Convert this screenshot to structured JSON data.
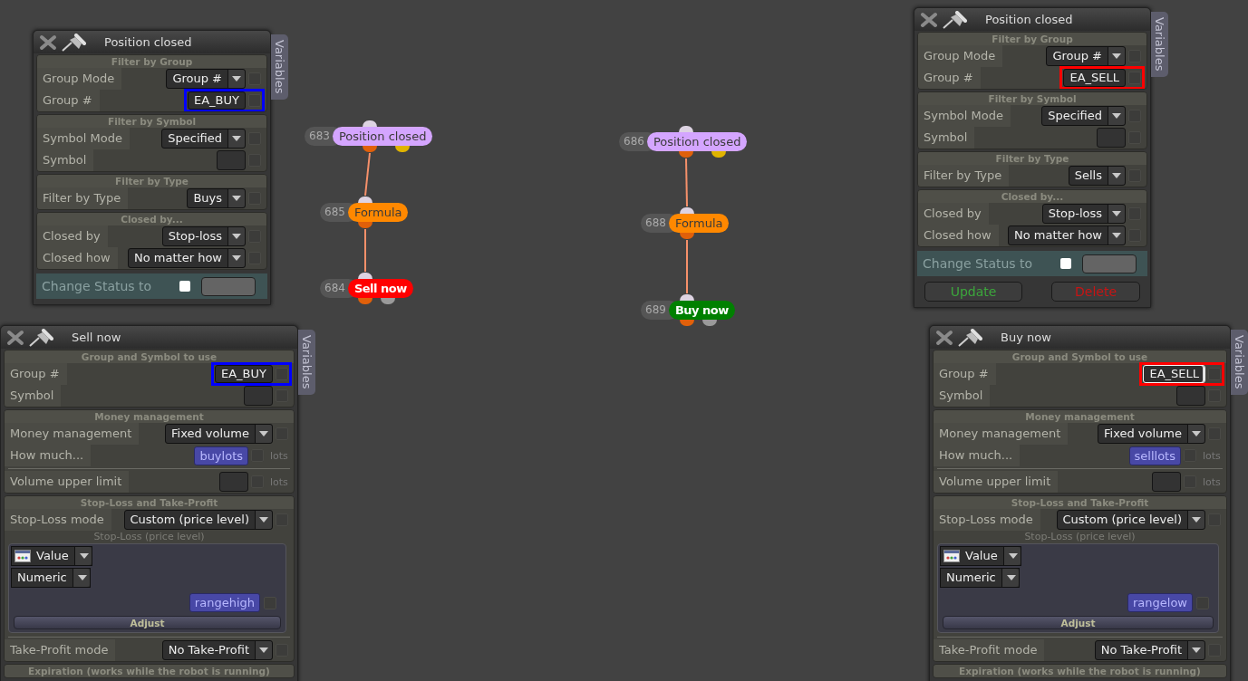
{
  "flows": [
    {
      "nodes": [
        {
          "number": "683",
          "label": "Position closed",
          "kind": "trigger",
          "color": "#d4a5ff"
        },
        {
          "number": "685",
          "label": "Formula",
          "kind": "formula",
          "color": "#ff8800"
        },
        {
          "number": "684",
          "label": "Sell now",
          "kind": "action",
          "color": "#ff0000"
        }
      ]
    },
    {
      "nodes": [
        {
          "number": "686",
          "label": "Position closed",
          "kind": "trigger",
          "color": "#d4a5ff"
        },
        {
          "number": "688",
          "label": "Formula",
          "kind": "formula",
          "color": "#ff8800"
        },
        {
          "number": "689",
          "label": "Buy now",
          "kind": "action",
          "color": "#008000"
        }
      ]
    }
  ],
  "panels": [
    {
      "title": "Position closed",
      "tab": "Variables",
      "sections": [
        {
          "heading": "Filter by Group",
          "rows": [
            {
              "kind": "field",
              "label": "Group Mode",
              "control": {
                "kind": "select",
                "value": "Group #"
              },
              "checked": false
            },
            {
              "kind": "field",
              "label": "Group #",
              "control": {
                "kind": "text",
                "value": "EA_BUY",
                "focused": false
              },
              "checked": false,
              "color": "#0000ff"
            }
          ]
        },
        {
          "heading": "Filter by Symbol",
          "rows": [
            {
              "kind": "field",
              "label": "Symbol Mode",
              "control": {
                "kind": "select",
                "value": "Specified"
              },
              "checked": false
            },
            {
              "kind": "field",
              "label": "Symbol",
              "control": {
                "kind": "empty"
              },
              "checked": false
            }
          ]
        },
        {
          "heading": "Filter by Type",
          "rows": [
            {
              "kind": "field",
              "label": "Filter by Type",
              "control": {
                "kind": "select",
                "value": "Buys"
              },
              "checked": false
            }
          ]
        },
        {
          "heading": "Closed by...",
          "rows": [
            {
              "kind": "field",
              "label": "Closed by",
              "control": {
                "kind": "select",
                "value": "Stop-loss"
              },
              "checked": false
            },
            {
              "kind": "field",
              "label": "Closed how",
              "control": {
                "kind": "select",
                "value": "No matter how"
              },
              "checked": false
            }
          ]
        }
      ],
      "status": {
        "label": "Change Status to",
        "checked": false
      }
    },
    {
      "title": "Sell now",
      "tab": "Variables",
      "sections": [
        {
          "heading": "Group and Symbol to use",
          "rows": [
            {
              "kind": "field",
              "label": "Group #",
              "control": {
                "kind": "text",
                "value": "EA_BUY",
                "focused": false
              },
              "checked": false,
              "color": "#0000ff"
            },
            {
              "kind": "field",
              "label": "Symbol",
              "control": {
                "kind": "empty"
              },
              "checked": false
            }
          ]
        },
        {
          "heading": "Money management",
          "rows": [
            {
              "kind": "field",
              "label": "Money management",
              "control": {
                "kind": "select",
                "value": "Fixed volume"
              },
              "checked": false
            },
            {
              "kind": "field",
              "label": "How much...",
              "control": {
                "kind": "variable",
                "value": "buylots"
              },
              "unit": "lots",
              "checked": false
            },
            {
              "kind": "divider"
            },
            {
              "kind": "field",
              "label": "Volume upper limit",
              "control": {
                "kind": "empty"
              },
              "unit": "lots",
              "checked": false
            }
          ]
        },
        {
          "heading": "Stop-Loss and Take-Profit",
          "rows": [
            {
              "kind": "field",
              "label": "Stop-Loss mode",
              "control": {
                "kind": "select",
                "value": "Custom (price level)"
              },
              "checked": false
            },
            {
              "kind": "caption",
              "text": "Stop-Loss (price level)"
            },
            {
              "kind": "expression",
              "source": "Value",
              "type": "Numeric",
              "variable": "rangehigh",
              "button": "Adjust",
              "checked": false
            },
            {
              "kind": "divider"
            },
            {
              "kind": "field",
              "label": "Take-Profit mode",
              "control": {
                "kind": "select",
                "value": "No Take-Profit"
              },
              "checked": false
            }
          ]
        },
        {
          "heading": "Expiration (works while the robot is running)"
        }
      ]
    },
    {
      "title": "Position closed",
      "tab": "Variables",
      "sections": [
        {
          "heading": "Filter by Group",
          "rows": [
            {
              "kind": "field",
              "label": "Group Mode",
              "control": {
                "kind": "select",
                "value": "Group #"
              },
              "checked": false
            },
            {
              "kind": "field",
              "label": "Group #",
              "control": {
                "kind": "text",
                "value": "EA_SELL",
                "focused": false
              },
              "checked": false,
              "color": "#ff0000"
            }
          ]
        },
        {
          "heading": "Filter by Symbol",
          "rows": [
            {
              "kind": "field",
              "label": "Symbol Mode",
              "control": {
                "kind": "select",
                "value": "Specified"
              },
              "checked": false
            },
            {
              "kind": "field",
              "label": "Symbol",
              "control": {
                "kind": "empty"
              },
              "checked": false
            }
          ]
        },
        {
          "heading": "Filter by Type",
          "rows": [
            {
              "kind": "field",
              "label": "Filter by Type",
              "control": {
                "kind": "select",
                "value": "Sells"
              },
              "checked": false
            }
          ]
        },
        {
          "heading": "Closed by...",
          "rows": [
            {
              "kind": "field",
              "label": "Closed by",
              "control": {
                "kind": "select",
                "value": "Stop-loss"
              },
              "checked": false
            },
            {
              "kind": "field",
              "label": "Closed how",
              "control": {
                "kind": "select",
                "value": "No matter how"
              },
              "checked": false
            }
          ]
        }
      ],
      "status": {
        "label": "Change Status to",
        "checked": false
      },
      "buttons": [
        {
          "label": "Update",
          "kind": "update"
        },
        {
          "label": "Delete",
          "kind": "delete"
        }
      ]
    },
    {
      "title": "Buy now",
      "tab": "Variables",
      "sections": [
        {
          "heading": "Group and Symbol to use",
          "rows": [
            {
              "kind": "field",
              "label": "Group #",
              "control": {
                "kind": "text",
                "value": "EA_SELL",
                "focused": true
              },
              "checked": false,
              "color": "#ff0000"
            },
            {
              "kind": "field",
              "label": "Symbol",
              "control": {
                "kind": "empty"
              },
              "checked": false
            }
          ]
        },
        {
          "heading": "Money management",
          "rows": [
            {
              "kind": "field",
              "label": "Money management",
              "control": {
                "kind": "select",
                "value": "Fixed volume"
              },
              "checked": false
            },
            {
              "kind": "field",
              "label": "How much...",
              "control": {
                "kind": "variable",
                "value": "selllots"
              },
              "unit": "lots",
              "checked": false
            },
            {
              "kind": "divider"
            },
            {
              "kind": "field",
              "label": "Volume upper limit",
              "control": {
                "kind": "empty"
              },
              "unit": "lots",
              "checked": false
            }
          ]
        },
        {
          "heading": "Stop-Loss and Take-Profit",
          "rows": [
            {
              "kind": "field",
              "label": "Stop-Loss mode",
              "control": {
                "kind": "select",
                "value": "Custom (price level)"
              },
              "checked": false
            },
            {
              "kind": "caption",
              "text": "Stop-Loss (price level)"
            },
            {
              "kind": "expression",
              "source": "Value",
              "type": "Numeric",
              "variable": "rangelow",
              "button": "Adjust",
              "checked": false
            },
            {
              "kind": "divider"
            },
            {
              "kind": "field",
              "label": "Take-Profit mode",
              "control": {
                "kind": "select",
                "value": "No Take-Profit"
              },
              "checked": false
            }
          ]
        },
        {
          "heading": "Expiration (works while the robot is running)"
        }
      ]
    }
  ]
}
